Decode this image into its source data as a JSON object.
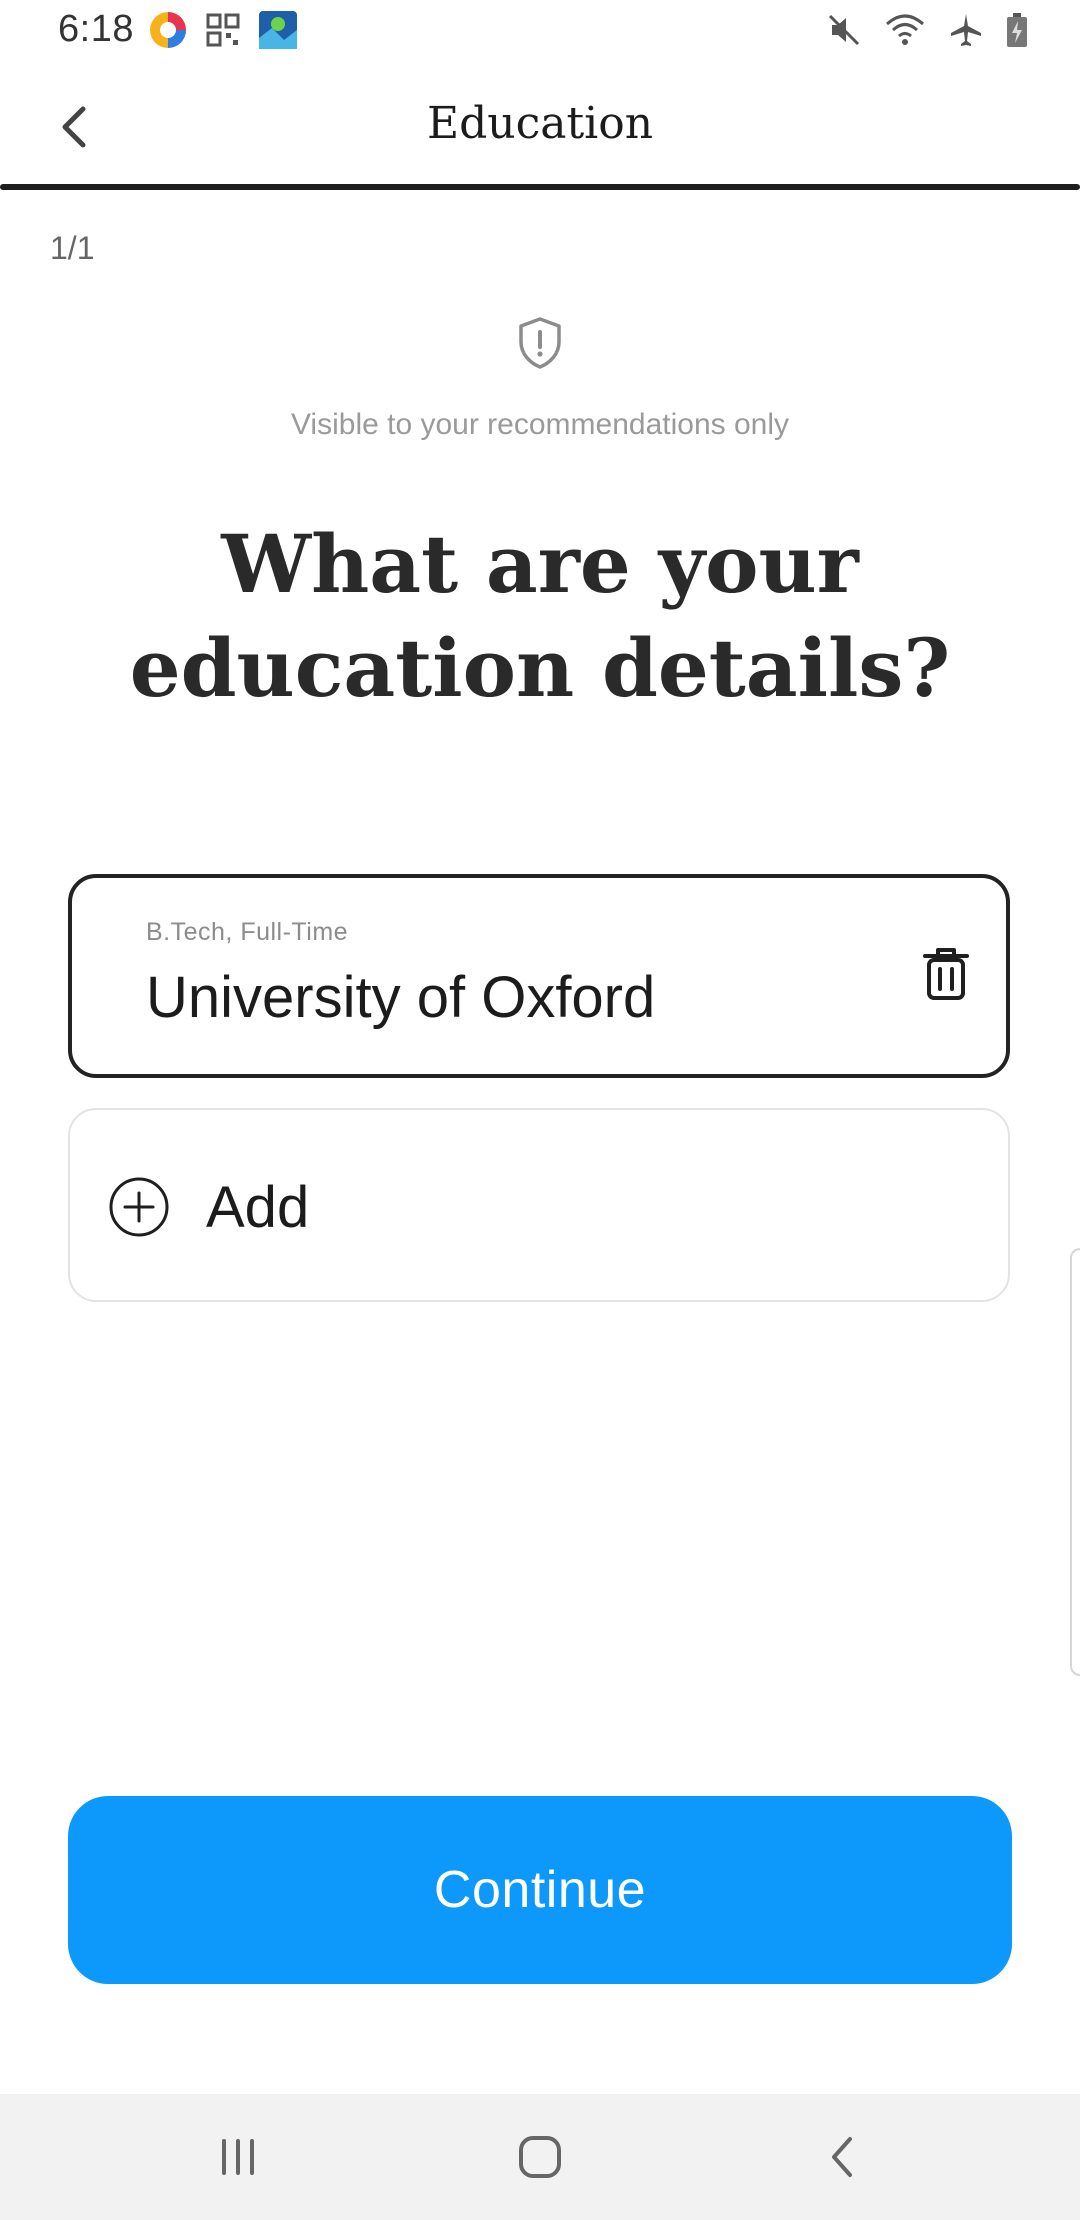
{
  "status_bar": {
    "time": "6:18",
    "left_icons": [
      "browser-app-icon",
      "qr-scanner-icon",
      "maps-app-icon"
    ],
    "right_icons": [
      "mute-icon",
      "wifi-icon",
      "airplane-mode-icon",
      "battery-charging-icon"
    ]
  },
  "app_bar": {
    "title": "Education",
    "back_icon": "chevron-left-icon"
  },
  "progress": "1/1",
  "visibility_note": "Visible to your recommendations only",
  "question": "What are your education details?",
  "education_entries": [
    {
      "degree": "B.Tech, Full-Time",
      "institution": "University of Oxford"
    }
  ],
  "add_label": "Add",
  "continue_label": "Continue",
  "colors": {
    "accent": "#0d99fb",
    "text_dark": "#1c1c1c",
    "muted": "#9a9a9a"
  }
}
